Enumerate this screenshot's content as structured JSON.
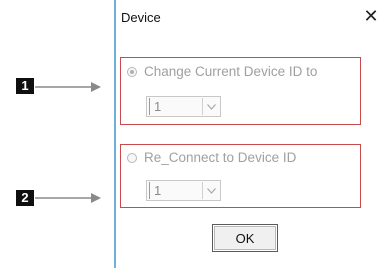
{
  "dialog": {
    "title": "Device",
    "close_glyph": "✕"
  },
  "option_change": {
    "label": "Change Current Device ID to",
    "selected": true,
    "device_id_value": "1"
  },
  "option_reconnect": {
    "label": "Re_Connect to Device ID",
    "selected": false,
    "device_id_value": "1"
  },
  "ok_button": {
    "label": "OK"
  },
  "callouts": [
    {
      "number": "1"
    },
    {
      "number": "2"
    }
  ],
  "colors": {
    "callout_frame": "#c84a4a",
    "dialog_border": "#6fb1d8",
    "disabled_text": "#a0a0a0"
  },
  "icons": {
    "close": "close-icon",
    "dropdown": "chevron-down-icon",
    "callout_arrow": "arrow-right-icon"
  }
}
